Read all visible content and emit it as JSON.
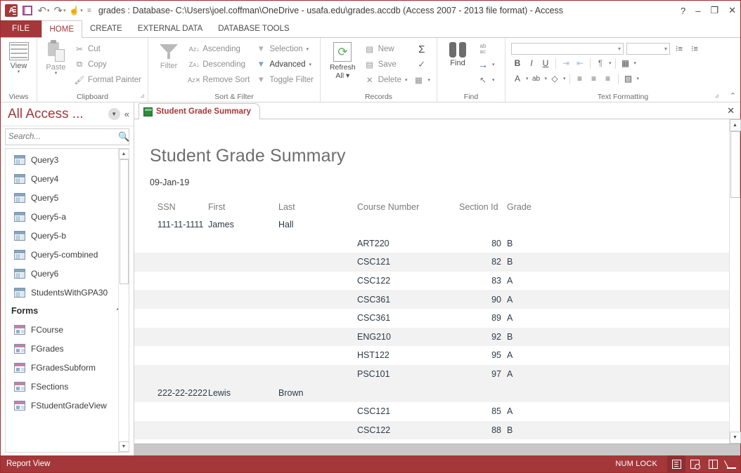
{
  "titlebar": {
    "app_icon": "access-logo",
    "quick_access": [
      {
        "name": "save-icon",
        "label": "Save"
      },
      {
        "name": "undo-icon",
        "label": "Undo"
      },
      {
        "name": "redo-icon",
        "label": "Redo"
      },
      {
        "name": "touch-mode-icon",
        "label": "Touch/Mouse Mode"
      },
      {
        "name": "customize-qat-icon",
        "label": "Customize Quick Access Toolbar"
      }
    ],
    "title": "grades : Database- C:\\Users\\joel.coffman\\OneDrive - usafa.edu\\grades.accdb (Access 2007 - 2013 file format) - Access",
    "help": "?",
    "minimize": "–",
    "restore": "❐",
    "close": "✕"
  },
  "ribbon": {
    "file_tab": "FILE",
    "tabs": [
      {
        "label": "HOME",
        "active": true
      },
      {
        "label": "CREATE",
        "active": false
      },
      {
        "label": "EXTERNAL DATA",
        "active": false
      },
      {
        "label": "DATABASE TOOLS",
        "active": false
      }
    ],
    "groups": [
      {
        "name": "views",
        "label": "Views",
        "items": [
          {
            "label": "View",
            "caption": "▾",
            "icon": "view-grid-icon"
          }
        ]
      },
      {
        "name": "clipboard",
        "label": "Clipboard",
        "dialog_launcher": "⊿",
        "items": [
          {
            "label": "Paste",
            "caption": "▾",
            "icon": "paste-icon"
          },
          {
            "label": "Cut",
            "icon": "scissors-icon"
          },
          {
            "label": "Copy",
            "icon": "copy-icon"
          },
          {
            "label": "Format Painter",
            "icon": "format-painter-icon"
          }
        ]
      },
      {
        "name": "sort-filter",
        "label": "Sort & Filter",
        "items": [
          {
            "label": "Filter",
            "icon": "funnel-icon"
          },
          {
            "label": "Ascending",
            "icon": "sort-ascending-icon"
          },
          {
            "label": "Descending",
            "icon": "sort-descending-icon"
          },
          {
            "label": "Remove Sort",
            "icon": "remove-sort-icon"
          },
          {
            "label": "Selection",
            "icon": "selection-icon",
            "caret": "▾"
          },
          {
            "label": "Advanced",
            "icon": "advanced-icon",
            "caret": "▾"
          },
          {
            "label": "Toggle Filter",
            "icon": "toggle-filter-icon"
          }
        ]
      },
      {
        "name": "records",
        "label": "Records",
        "items": [
          {
            "label": "Refresh",
            "label2": "All ▾",
            "icon": "refresh-icon"
          },
          {
            "label": "New",
            "icon": "new-record-icon"
          },
          {
            "label": "Save",
            "icon": "save-record-icon"
          },
          {
            "label": "Delete",
            "icon": "delete-record-icon",
            "caret": "▾"
          },
          {
            "label": "Totals",
            "icon": "sigma-icon"
          },
          {
            "label": "Spelling",
            "icon": "spelling-check-icon"
          },
          {
            "label": "More",
            "icon": "more-records-icon",
            "caret": "▾"
          }
        ]
      },
      {
        "name": "find",
        "label": "Find",
        "items": [
          {
            "label": "Find",
            "icon": "binoculars-icon"
          },
          {
            "label": "Replace",
            "icon": "replace-abac-icon"
          },
          {
            "label": "Go To",
            "icon": "goto-arrow-icon",
            "caret": "▾"
          },
          {
            "label": "Select",
            "icon": "select-pointer-icon",
            "caret": "▾"
          }
        ]
      },
      {
        "name": "text-formatting",
        "label": "Text Formatting",
        "dialog_launcher": "⊿",
        "font_name": "",
        "font_size": "",
        "items": [
          {
            "label": "Bold",
            "icon": "bold-icon",
            "glyph": "B"
          },
          {
            "label": "Italic",
            "icon": "italic-icon",
            "glyph": "I"
          },
          {
            "label": "Underline",
            "icon": "underline-icon",
            "glyph": "U"
          },
          {
            "label": "Increase Indent",
            "icon": "increase-indent-icon"
          },
          {
            "label": "Decrease Indent",
            "icon": "decrease-indent-icon"
          },
          {
            "label": "Text Direction",
            "icon": "text-direction-icon",
            "caret": "▾"
          },
          {
            "label": "Gridlines",
            "icon": "gridlines-icon",
            "caret": "▾"
          },
          {
            "label": "Font Color",
            "icon": "font-color-icon",
            "glyph": "A",
            "caret": "▾"
          },
          {
            "label": "Text Highlight",
            "icon": "text-highlight-icon",
            "caret": "▾"
          },
          {
            "label": "Background Color",
            "icon": "fill-color-icon",
            "caret": "▾"
          },
          {
            "label": "Align Left",
            "icon": "align-left-icon"
          },
          {
            "label": "Center",
            "icon": "align-center-icon"
          },
          {
            "label": "Align Right",
            "icon": "align-right-icon"
          },
          {
            "label": "Alternate Row Color",
            "icon": "alternate-row-color-icon",
            "caret": "▾"
          },
          {
            "label": "Bulleted List",
            "icon": "bullet-list-icon"
          },
          {
            "label": "Numbered List",
            "icon": "numbered-list-icon"
          }
        ],
        "collapse_ribbon": "⌃"
      }
    ]
  },
  "navpane": {
    "title": "All Access ...",
    "dropdown_icon": "chevron-down-icon",
    "collapse_icon": "collapse-pane-icon",
    "search": {
      "placeholder": "Search...",
      "value": "",
      "icon": "search-icon"
    },
    "items": [
      {
        "label": "Query3",
        "type": "query"
      },
      {
        "label": "Query4",
        "type": "query"
      },
      {
        "label": "Query5",
        "type": "query"
      },
      {
        "label": "Query5-a",
        "type": "query"
      },
      {
        "label": "Query5-b",
        "type": "query"
      },
      {
        "label": "Query5-combined",
        "type": "query"
      },
      {
        "label": "Query6",
        "type": "query"
      },
      {
        "label": "StudentsWithGPA30",
        "type": "query"
      },
      {
        "label": "Forms",
        "type": "group",
        "collapse_icon": "chevron-up-icon"
      },
      {
        "label": "FCourse",
        "type": "form"
      },
      {
        "label": "FGrades",
        "type": "form"
      },
      {
        "label": "FGradesSubform",
        "type": "form"
      },
      {
        "label": "FSections",
        "type": "form"
      },
      {
        "label": "FStudentGradeView",
        "type": "form"
      }
    ],
    "scroll_up": "▲",
    "scroll_down": "▼"
  },
  "document": {
    "tab": {
      "label": "Student Grade Summary",
      "icon": "report-object-icon"
    },
    "close_label": "✕",
    "scroll_up": "▲",
    "scroll_down": "▼"
  },
  "report": {
    "title": "Student Grade Summary",
    "date": "09-Jan-19",
    "columns": [
      "SSN",
      "First",
      "Last",
      "Course Number",
      "Section Id",
      "Grade"
    ],
    "rows": [
      {
        "ssn": "111-11-1111",
        "first": "James",
        "last": "Hall",
        "course": "",
        "section": "",
        "grade": "",
        "alt": false
      },
      {
        "ssn": "",
        "first": "",
        "last": "",
        "course": "ART220",
        "section": "80",
        "grade": "B",
        "alt": false
      },
      {
        "ssn": "",
        "first": "",
        "last": "",
        "course": "CSC121",
        "section": "82",
        "grade": "B",
        "alt": true
      },
      {
        "ssn": "",
        "first": "",
        "last": "",
        "course": "CSC122",
        "section": "83",
        "grade": "A",
        "alt": false
      },
      {
        "ssn": "",
        "first": "",
        "last": "",
        "course": "CSC361",
        "section": "90",
        "grade": "A",
        "alt": true
      },
      {
        "ssn": "",
        "first": "",
        "last": "",
        "course": "CSC361",
        "section": "89",
        "grade": "A",
        "alt": false
      },
      {
        "ssn": "",
        "first": "",
        "last": "",
        "course": "ENG210",
        "section": "92",
        "grade": "B",
        "alt": true
      },
      {
        "ssn": "",
        "first": "",
        "last": "",
        "course": "HST122",
        "section": "95",
        "grade": "A",
        "alt": false
      },
      {
        "ssn": "",
        "first": "",
        "last": "",
        "course": "PSC101",
        "section": "97",
        "grade": "A",
        "alt": true
      },
      {
        "ssn": "222-22-2222",
        "first": "Lewis",
        "last": "Brown",
        "course": "",
        "section": "",
        "grade": "",
        "alt": true
      },
      {
        "ssn": "",
        "first": "",
        "last": "",
        "course": "CSC121",
        "section": "85",
        "grade": "A",
        "alt": false
      },
      {
        "ssn": "",
        "first": "",
        "last": "",
        "course": "CSC122",
        "section": "88",
        "grade": "B",
        "alt": true
      }
    ]
  },
  "statusbar": {
    "view_label": "Report View",
    "num_lock": "NUM LOCK",
    "view_buttons": [
      {
        "name": "report-view-button",
        "icon": "report-view-icon",
        "active": true
      },
      {
        "name": "print-preview-button",
        "icon": "print-preview-icon",
        "active": false
      },
      {
        "name": "layout-view-button",
        "icon": "layout-view-icon",
        "active": false
      },
      {
        "name": "design-view-button",
        "icon": "design-view-icon",
        "active": false
      }
    ]
  },
  "colors": {
    "accent": "#a4373a",
    "accent_dark": "#8d2f32",
    "report_title": "#6e6e6e",
    "alt_row": "#f2f2f2"
  }
}
